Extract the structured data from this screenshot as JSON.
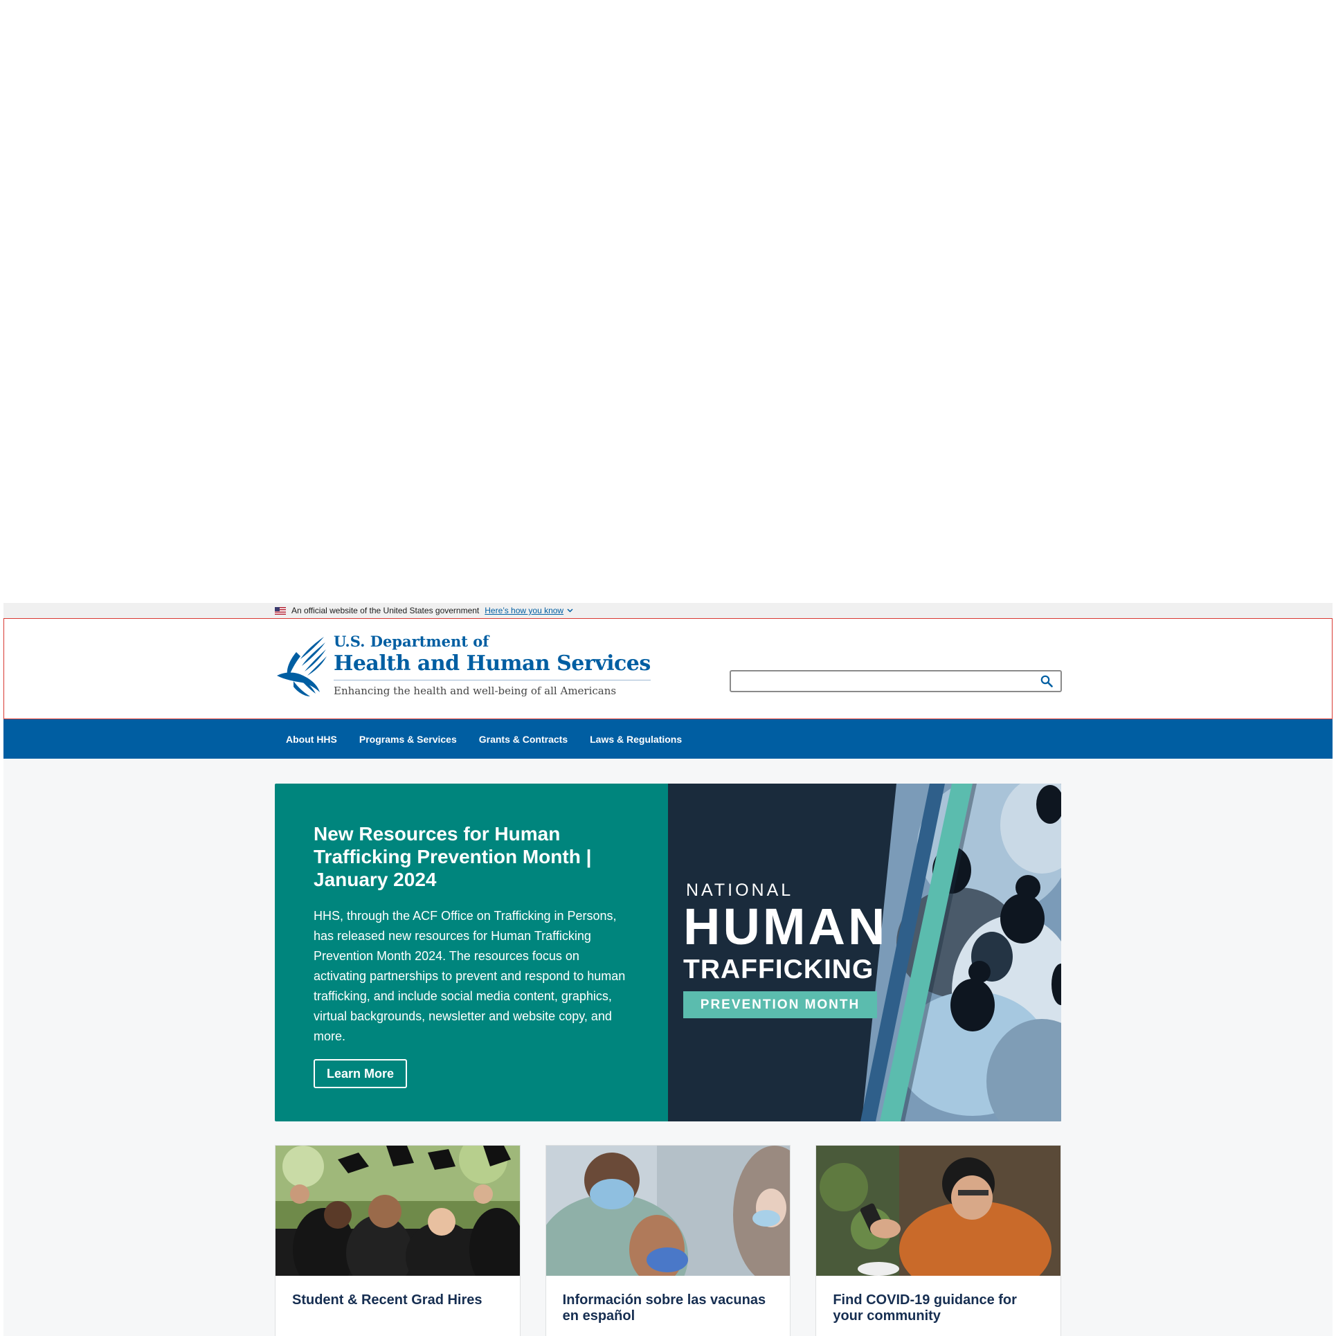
{
  "gov_banner": {
    "text": "An official website of the United States government",
    "link": "Here’s how you know",
    "link_icon": "chevron-down-icon"
  },
  "header": {
    "logo_line1": "U.S. Department of",
    "logo_line2": "Health and Human Services",
    "tagline": "Enhancing the health and well-being of all Americans",
    "logo_icon": "hhs-eagle-logo",
    "search": {
      "placeholder": "",
      "value": "",
      "button_icon": "search-icon"
    }
  },
  "nav": {
    "items": [
      {
        "label": "About HHS"
      },
      {
        "label": "Programs & Services"
      },
      {
        "label": "Grants & Contracts"
      },
      {
        "label": "Laws & Regulations"
      }
    ]
  },
  "hero": {
    "title": "New Resources for Human Trafficking Prevention Month | January 2024",
    "body": "HHS, through the ACF Office on Trafficking in Persons, has released new resources for Human Trafficking Prevention Month 2024. The resources focus on activating partnerships to prevent and respond to human trafficking, and include social media content, graphics, virtual backgrounds, newsletter and website copy, and more.",
    "button": "Learn More",
    "poster": {
      "national": "NATIONAL",
      "human": "HUMAN",
      "trafficking": "TRAFFICKING",
      "prevention": "PREVENTION MONTH"
    }
  },
  "cards": [
    {
      "title": "Student & Recent Grad Hires",
      "image": "graduates-photo"
    },
    {
      "title": "Información sobre las vacunas en español",
      "image": "vaccination-photo"
    },
    {
      "title": "Find COVID-19 guidance for your community",
      "image": "woman-with-phone-photo"
    }
  ],
  "colors": {
    "primary_blue": "#005ea2",
    "hero_teal": "#00857d",
    "hero_navy": "#1a2b3c",
    "accent_teal": "#5bbcae",
    "card_title": "#162e51",
    "page_bg": "#f6f7f8"
  }
}
